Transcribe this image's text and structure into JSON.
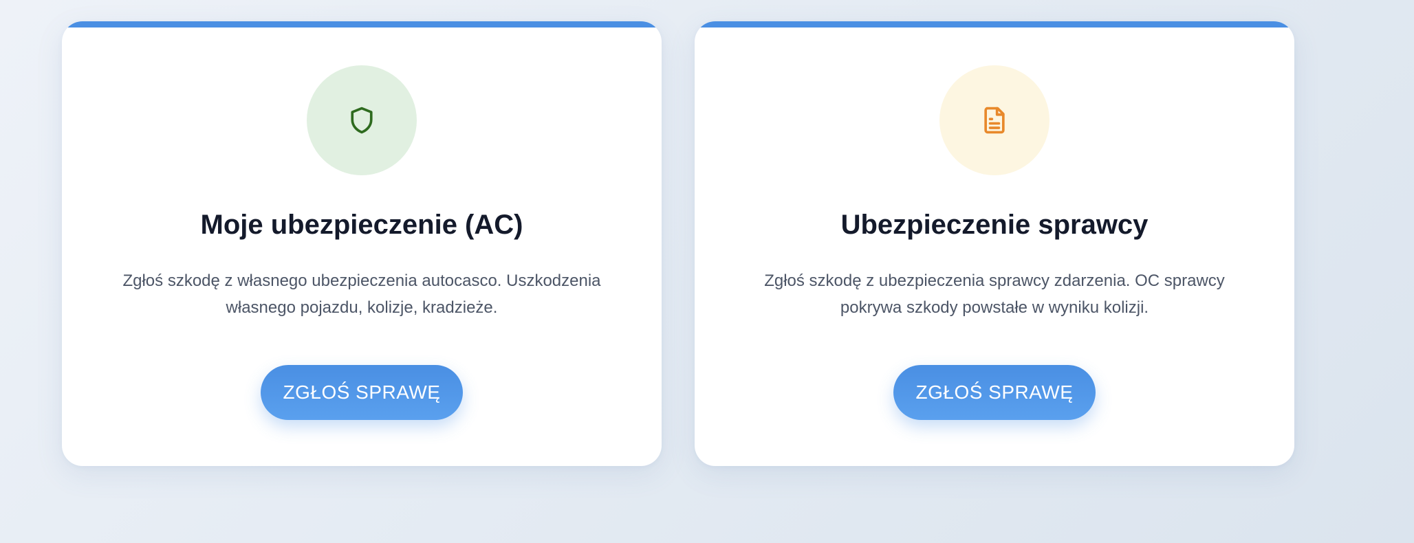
{
  "cards": [
    {
      "icon": "shield-icon",
      "icon_color": "#2e6b1f",
      "icon_bg": "#e1f0e1",
      "title": "Moje ubezpieczenie (AC)",
      "description": "Zgłoś szkodę z własnego ubezpieczenia autocasco. Uszkodzenia własnego pojazdu, kolizje, kradzieże.",
      "button_label": "ZGŁOŚ SPRAWĘ"
    },
    {
      "icon": "document-icon",
      "icon_color": "#e8892b",
      "icon_bg": "#fdf6e1",
      "title": "Ubezpieczenie sprawcy",
      "description": "Zgłoś szkodę z ubezpieczenia sprawcy zdarzenia. OC sprawcy pokrywa szkody powstałe w wyniku kolizji.",
      "button_label": "ZGŁOŚ SPRAWĘ"
    }
  ],
  "colors": {
    "accent": "#4a8fe3",
    "title": "#141a2b",
    "text": "#4c5566"
  }
}
